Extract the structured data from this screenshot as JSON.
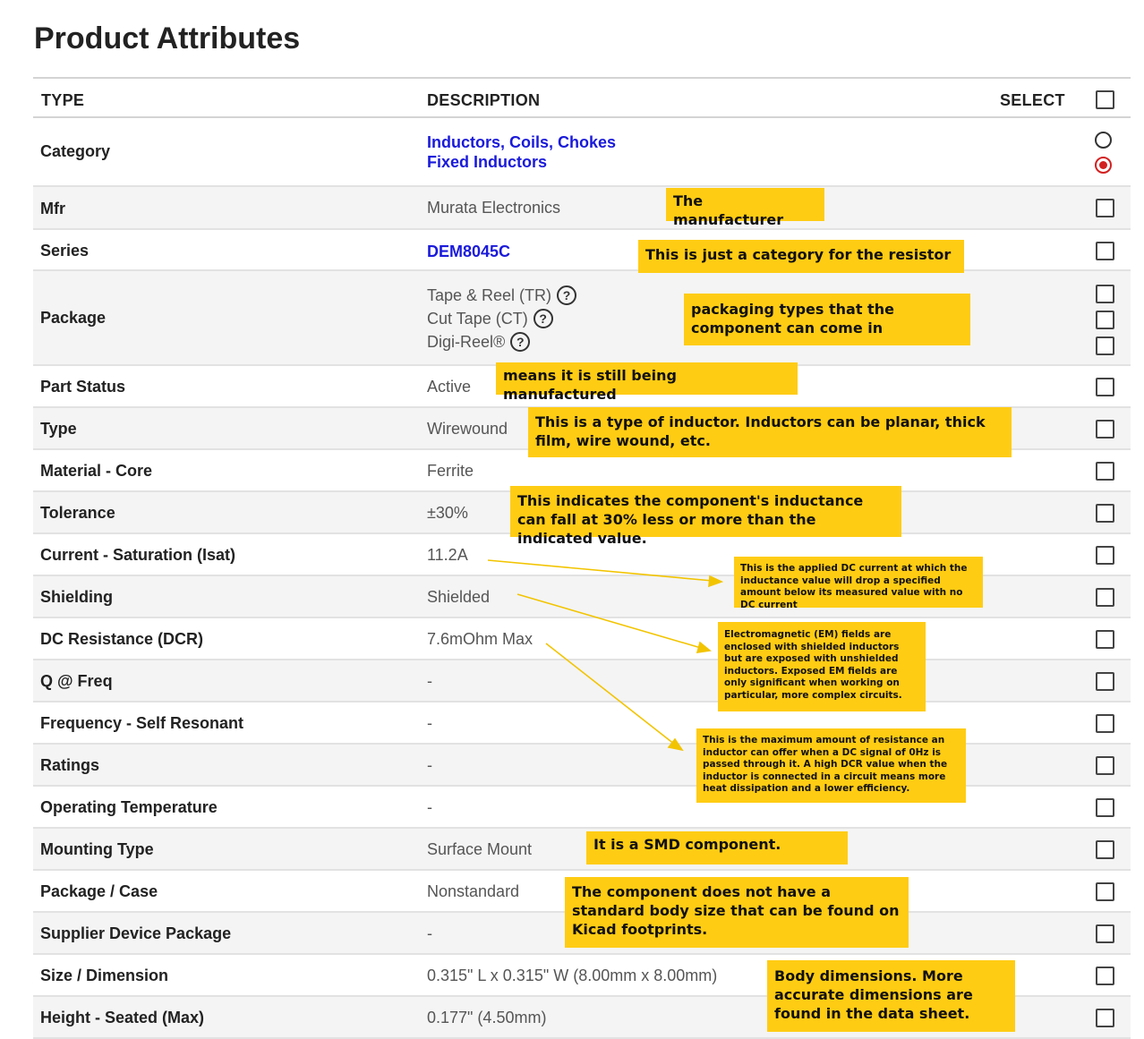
{
  "page": {
    "title": "Product Attributes"
  },
  "table": {
    "headers": {
      "type": "TYPE",
      "description": "DESCRIPTION",
      "select": "SELECT"
    },
    "rows": [
      {
        "type": "Category",
        "links": [
          "Inductors, Coils, Chokes",
          "Fixed Inductors"
        ]
      },
      {
        "type": "Mfr",
        "value": "Murata Electronics"
      },
      {
        "type": "Series",
        "link": "DEM8045C"
      },
      {
        "type": "Package",
        "options": [
          "Tape & Reel (TR)",
          "Cut Tape (CT)",
          "Digi-Reel®"
        ]
      },
      {
        "type": "Part Status",
        "value": "Active"
      },
      {
        "type": "Type",
        "value": "Wirewound"
      },
      {
        "type": "Material - Core",
        "value": "Ferrite"
      },
      {
        "type": "Tolerance",
        "value": "±30%"
      },
      {
        "type": "Current - Saturation (Isat)",
        "value": "11.2A"
      },
      {
        "type": "Shielding",
        "value": "Shielded"
      },
      {
        "type": "DC Resistance (DCR)",
        "value": "7.6mOhm Max"
      },
      {
        "type": "Q @ Freq",
        "value": "-"
      },
      {
        "type": "Frequency - Self Resonant",
        "value": "-"
      },
      {
        "type": "Ratings",
        "value": "-"
      },
      {
        "type": "Operating Temperature",
        "value": "-"
      },
      {
        "type": "Mounting Type",
        "value": "Surface Mount"
      },
      {
        "type": "Package / Case",
        "value": "Nonstandard"
      },
      {
        "type": "Supplier Device Package",
        "value": "-"
      },
      {
        "type": "Size / Dimension",
        "value": "0.315\" L x 0.315\" W (8.00mm x 8.00mm)"
      },
      {
        "type": "Height - Seated (Max)",
        "value": "0.177\" (4.50mm)"
      }
    ]
  },
  "annotations": {
    "mfr": "The manufacturer",
    "series": "This is just a category for the resistor",
    "package": "packaging types that the component can come in",
    "part_status": "means it is still being manufactured",
    "type": "This is a type of inductor. Inductors can be planar, thick film, wire wound, etc.",
    "tolerance": "This indicates the component's inductance can fall at 30% less or more than the indicated value.",
    "isat": "This is the applied DC current at which the inductance value will drop a specified amount below its measured value with no DC current",
    "shielding": "Electromagnetic (EM) fields are enclosed with shielded inductors but are exposed with unshielded inductors. Exposed EM fields are only significant when working on particular, more complex circuits.",
    "dcr": "This is the maximum amount of resistance an inductor can offer when a DC signal of 0Hz is passed through it. A high DCR value when the inductor is connected in a circuit means more heat dissipation and a lower efficiency.",
    "mounting": "It is a SMD component.",
    "package_case": "The component does not have a standard body size that can be found on Kicad footprints.",
    "size": "Body dimensions. More accurate dimensions are found in the data sheet."
  },
  "colors": {
    "annotation": "#ffcc14",
    "link": "#1a1adb",
    "radio_selected": "#d32020",
    "row_alt": "#f4f4f4"
  }
}
